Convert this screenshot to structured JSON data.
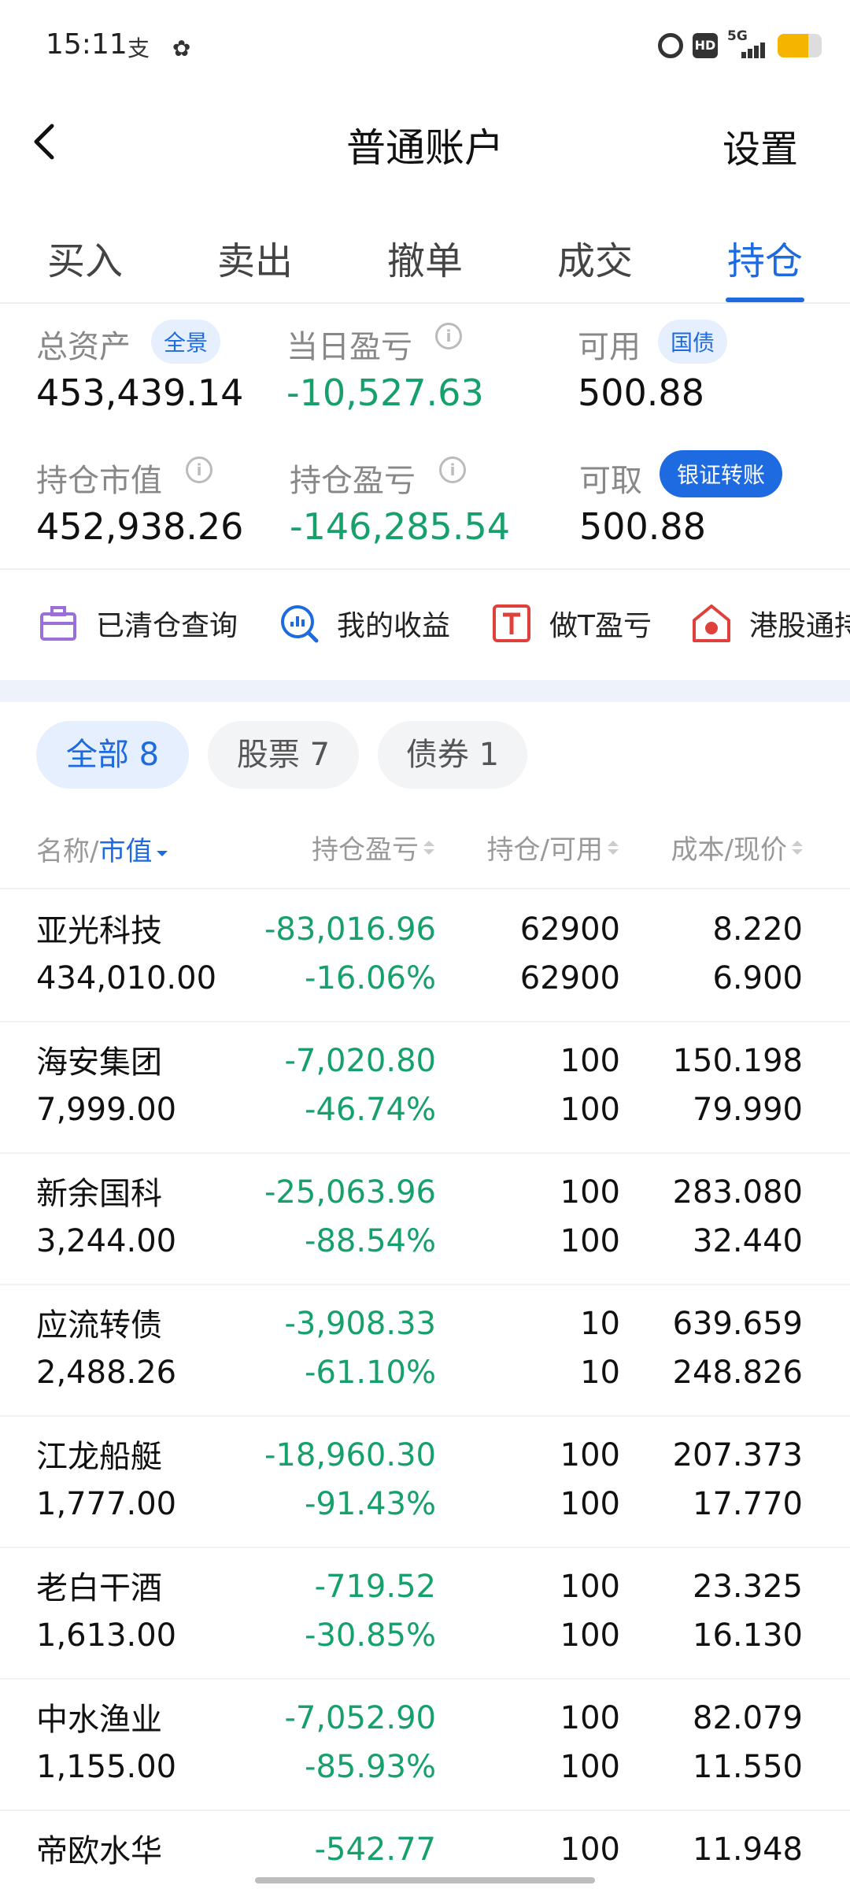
{
  "status_bar": {
    "time": "15:11",
    "app_icons": "支 ✿",
    "network": "5G",
    "battery_pct": 70
  },
  "header": {
    "title": "普通账户",
    "settings": "设置"
  },
  "tabs": [
    {
      "label": "买入"
    },
    {
      "label": "卖出"
    },
    {
      "label": "撤单"
    },
    {
      "label": "成交"
    },
    {
      "label": "持仓"
    }
  ],
  "assets": {
    "total_label": "总资产",
    "total_tag": "全景",
    "total_value": "453,439.14",
    "daily_pl_label": "当日盈亏",
    "daily_pl_value": "-10,527.63",
    "available_label": "可用",
    "available_tag": "国债",
    "available_value": "500.88",
    "market_value_label": "持仓市值",
    "market_value": "452,938.26",
    "position_pl_label": "持仓盈亏",
    "position_pl_value": "-146,285.54",
    "withdrawable_label": "可取",
    "withdrawable_tag": "银证转账",
    "withdrawable_value": "500.88",
    "info_glyph": "i"
  },
  "quick_links": [
    {
      "label": "已清仓查询",
      "icon": "briefcase-icon"
    },
    {
      "label": "我的收益",
      "icon": "chart-search-icon"
    },
    {
      "label": "做T盈亏",
      "icon": "t-box-icon"
    },
    {
      "label": "港股通持",
      "icon": "hk-house-icon"
    }
  ],
  "filters": [
    {
      "label": "全部 8"
    },
    {
      "label": "股票 7"
    },
    {
      "label": "债券 1"
    }
  ],
  "table_header": {
    "name_part": "名称/",
    "mv_part": "市值",
    "pl": "持仓盈亏",
    "hold": "持仓/可用",
    "cost": "成本/现价"
  },
  "holdings": [
    {
      "name": "亚光科技",
      "market_value": "434,010.00",
      "pl": "-83,016.96",
      "pl_pct": "-16.06%",
      "holding": "62900",
      "available": "62900",
      "cost": "8.220",
      "price": "6.900"
    },
    {
      "name": "海安集团",
      "market_value": "7,999.00",
      "pl": "-7,020.80",
      "pl_pct": "-46.74%",
      "holding": "100",
      "available": "100",
      "cost": "150.198",
      "price": "79.990"
    },
    {
      "name": "新余国科",
      "market_value": "3,244.00",
      "pl": "-25,063.96",
      "pl_pct": "-88.54%",
      "holding": "100",
      "available": "100",
      "cost": "283.080",
      "price": "32.440"
    },
    {
      "name": "应流转债",
      "market_value": "2,488.26",
      "pl": "-3,908.33",
      "pl_pct": "-61.10%",
      "holding": "10",
      "available": "10",
      "cost": "639.659",
      "price": "248.826"
    },
    {
      "name": "江龙船艇",
      "market_value": "1,777.00",
      "pl": "-18,960.30",
      "pl_pct": "-91.43%",
      "holding": "100",
      "available": "100",
      "cost": "207.373",
      "price": "17.770"
    },
    {
      "name": "老白干酒",
      "market_value": "1,613.00",
      "pl": "-719.52",
      "pl_pct": "-30.85%",
      "holding": "100",
      "available": "100",
      "cost": "23.325",
      "price": "16.130"
    },
    {
      "name": "中水渔业",
      "market_value": "1,155.00",
      "pl": "-7,052.90",
      "pl_pct": "-85.93%",
      "holding": "100",
      "available": "100",
      "cost": "82.079",
      "price": "11.550"
    },
    {
      "name": "帝欧水华",
      "market_value": "",
      "pl": "-542.77",
      "pl_pct": "",
      "holding": "100",
      "available": "",
      "cost": "11.948",
      "price": ""
    }
  ],
  "colors": {
    "accent": "#1e6ae0",
    "loss": "#16a06b",
    "muted": "#888888"
  }
}
